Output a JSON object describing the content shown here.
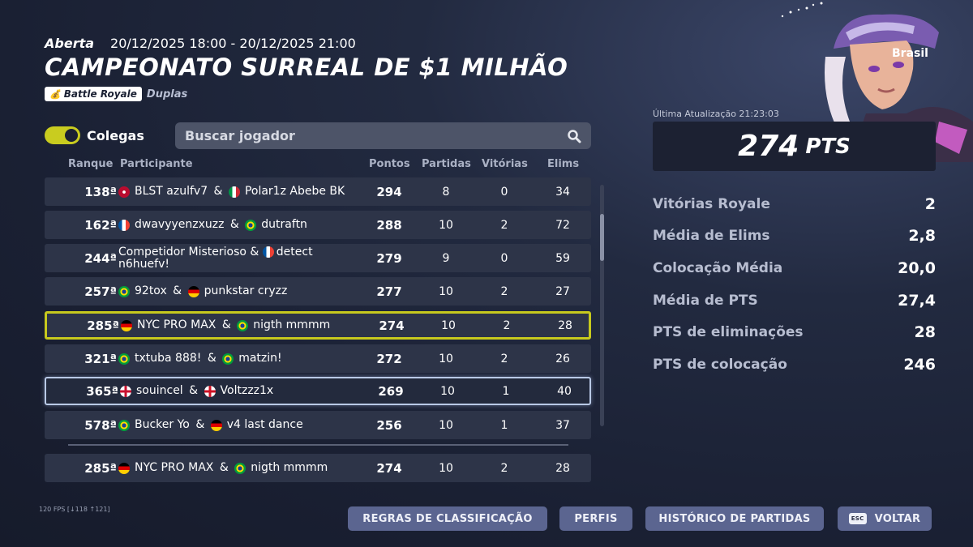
{
  "header": {
    "status": "Aberta",
    "datetime": "20/12/2025 18:00 - 20/12/2025 21:00",
    "title": "CAMPEONATO SURREAL DE $1 MILHÃO",
    "mode_badge": "Battle Royale",
    "mode_type": "Duplas"
  },
  "filters": {
    "toggle_label": "Colegas",
    "toggle_on": true,
    "search_placeholder": "Buscar jogador"
  },
  "table": {
    "columns": {
      "rank": "Ranque",
      "participant": "Participante",
      "points": "Pontos",
      "matches": "Partidas",
      "wins": "Vitórias",
      "elims": "Elims"
    },
    "rows": [
      {
        "rank": "138ª",
        "p1": "BLST azulfv7",
        "p1_flag": "norway",
        "p2": "Polar1z Abebe BK",
        "p2_flag": "italy",
        "points": "294",
        "matches": "8",
        "wins": "0",
        "elims": "34"
      },
      {
        "rank": "162ª",
        "p1": "dwavyyenzxuzz",
        "p1_flag": "france",
        "p2": "dutraftn",
        "p2_flag": "brazil",
        "points": "288",
        "matches": "10",
        "wins": "2",
        "elims": "72"
      },
      {
        "rank": "244ª",
        "p1": "Competidor Misterioso",
        "p1_flag": "",
        "p2": "detect n6huefv!",
        "p2_flag": "france",
        "points": "279",
        "matches": "9",
        "wins": "0",
        "elims": "59"
      },
      {
        "rank": "257ª",
        "p1": "92tox",
        "p1_flag": "brazil",
        "p2": "punkstar cryzz",
        "p2_flag": "germany",
        "points": "277",
        "matches": "10",
        "wins": "2",
        "elims": "27"
      },
      {
        "rank": "285ª",
        "p1": "NYC PRO MAX",
        "p1_flag": "germany",
        "p2": "nigth mmmm",
        "p2_flag": "brazil",
        "points": "274",
        "matches": "10",
        "wins": "2",
        "elims": "28",
        "highlight": "me"
      },
      {
        "rank": "321ª",
        "p1": "txtuba 888!",
        "p1_flag": "brazil",
        "p2": "matzin!",
        "p2_flag": "brazil",
        "points": "272",
        "matches": "10",
        "wins": "2",
        "elims": "26"
      },
      {
        "rank": "365ª",
        "p1": "souincel",
        "p1_flag": "uk",
        "p2": "Voltzzz1x",
        "p2_flag": "england",
        "points": "269",
        "matches": "10",
        "wins": "1",
        "elims": "40",
        "highlight": "selected"
      },
      {
        "rank": "578ª",
        "p1": "Bucker Yo",
        "p1_flag": "brazil",
        "p2": "v4 last dance",
        "p2_flag": "germany",
        "points": "256",
        "matches": "10",
        "wins": "1",
        "elims": "37"
      }
    ],
    "pinned": {
      "rank": "285ª",
      "p1": "NYC PRO MAX",
      "p1_flag": "germany",
      "p2": "nigth mmmm",
      "p2_flag": "brazil",
      "points": "274",
      "matches": "10",
      "wins": "2",
      "elims": "28"
    }
  },
  "panel": {
    "country": "Brasil",
    "last_update": "Última Atualização 21:23:03",
    "points_value": "274",
    "points_unit": "PTS",
    "stats": [
      {
        "label": "Vitórias Royale",
        "value": "2"
      },
      {
        "label": "Média de Elims",
        "value": "2,8"
      },
      {
        "label": "Colocação Média",
        "value": "20,0"
      },
      {
        "label": "Média de PTS",
        "value": "27,4"
      },
      {
        "label": "PTS de eliminações",
        "value": "28"
      },
      {
        "label": "PTS de colocação",
        "value": "246"
      }
    ]
  },
  "footer": {
    "fps": "120 FPS [↓118 ↑121]",
    "buttons": {
      "rules": "REGRAS DE CLASSIFICAÇÃO",
      "profiles": "PERFIS",
      "history": "HISTÓRICO DE PARTIDAS",
      "esc_key": "ESC",
      "back": "VOLTAR"
    }
  },
  "colors": {
    "accent_yellow": "#c7c91d",
    "button_bg": "#5b6590",
    "row_bg": "#2d3448",
    "background": "#1a2033"
  }
}
